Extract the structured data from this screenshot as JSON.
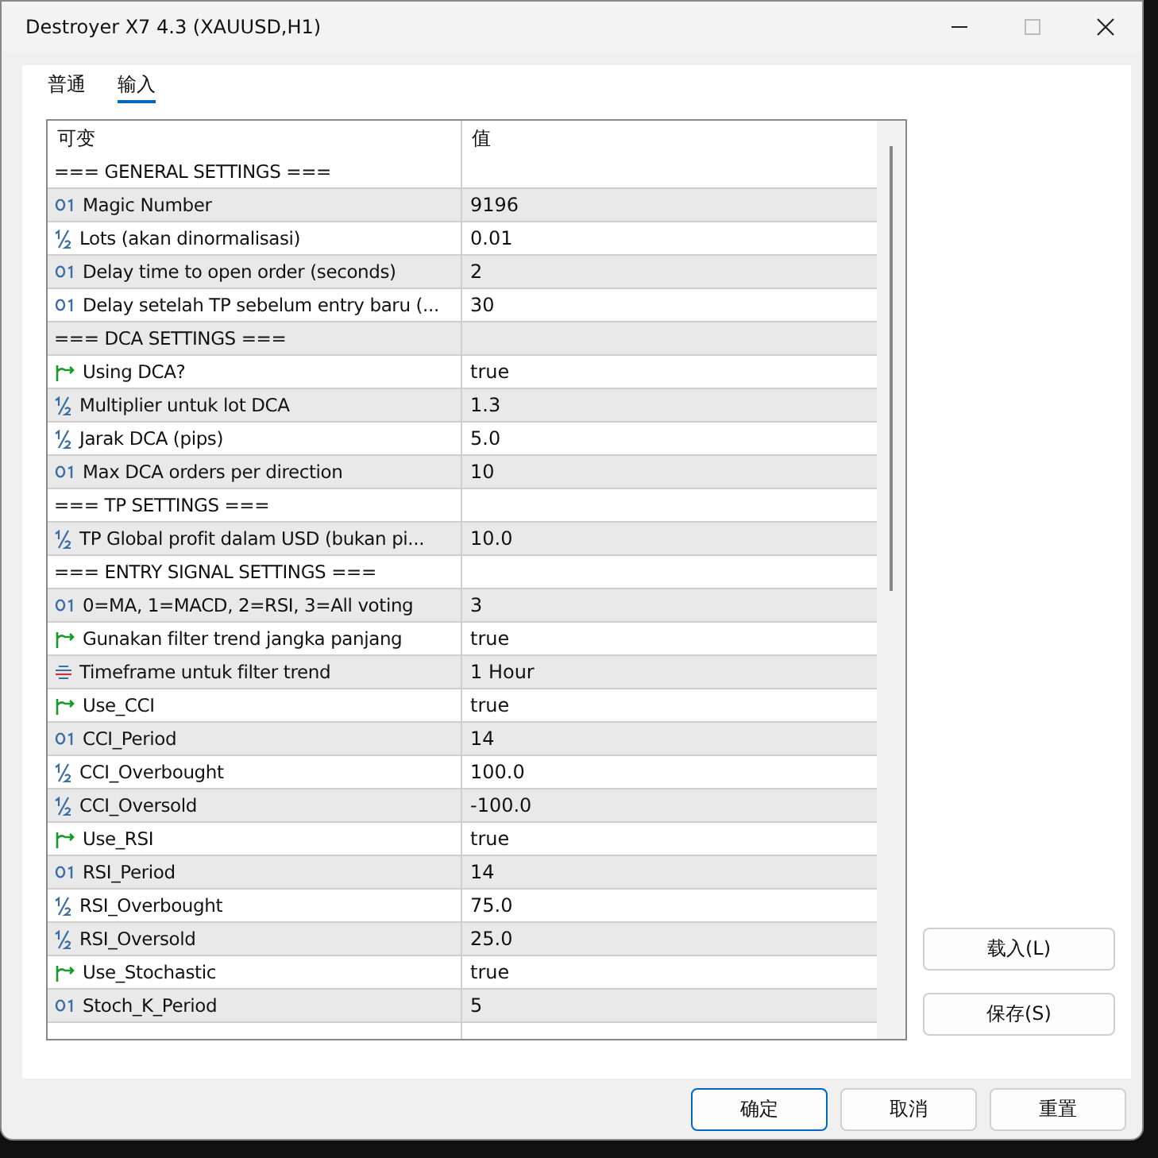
{
  "window": {
    "title": "Destroyer X7 4.3 (XAUUSD,H1)"
  },
  "tabs": [
    {
      "label": "普通",
      "selected": false
    },
    {
      "label": "输入",
      "selected": true
    }
  ],
  "table": {
    "columns": [
      "可变",
      "值"
    ],
    "rows": [
      {
        "kind": "group",
        "name": "=== GENERAL SETTINGS ===",
        "value": ""
      },
      {
        "kind": "int",
        "name": "Magic Number",
        "value": "9196"
      },
      {
        "kind": "double",
        "name": "Lots (akan dinormalisasi)",
        "value": "0.01"
      },
      {
        "kind": "int",
        "name": "Delay time to open order (seconds)",
        "value": "2"
      },
      {
        "kind": "int",
        "name": "Delay setelah TP sebelum entry baru (...",
        "value": "30"
      },
      {
        "kind": "group",
        "name": "=== DCA SETTINGS ===",
        "value": ""
      },
      {
        "kind": "bool",
        "name": "Using DCA?",
        "value": "true"
      },
      {
        "kind": "double",
        "name": "Multiplier untuk lot DCA",
        "value": "1.3"
      },
      {
        "kind": "double",
        "name": "Jarak DCA (pips)",
        "value": "5.0"
      },
      {
        "kind": "int",
        "name": "Max DCA orders per direction",
        "value": "10"
      },
      {
        "kind": "group",
        "name": "=== TP SETTINGS ===",
        "value": ""
      },
      {
        "kind": "double",
        "name": "TP Global profit dalam USD (bukan pi...",
        "value": "10.0"
      },
      {
        "kind": "group",
        "name": "=== ENTRY SIGNAL SETTINGS ===",
        "value": ""
      },
      {
        "kind": "int",
        "name": "0=MA, 1=MACD, 2=RSI, 3=All voting",
        "value": "3"
      },
      {
        "kind": "bool",
        "name": "Gunakan filter trend jangka panjang",
        "value": "true"
      },
      {
        "kind": "enum",
        "name": "Timeframe untuk filter trend",
        "value": "1 Hour"
      },
      {
        "kind": "bool",
        "name": "Use_CCI",
        "value": "true"
      },
      {
        "kind": "int",
        "name": "CCI_Period",
        "value": "14"
      },
      {
        "kind": "double",
        "name": "CCI_Overbought",
        "value": "100.0"
      },
      {
        "kind": "double",
        "name": "CCI_Oversold",
        "value": "-100.0"
      },
      {
        "kind": "bool",
        "name": "Use_RSI",
        "value": "true"
      },
      {
        "kind": "int",
        "name": "RSI_Period",
        "value": "14"
      },
      {
        "kind": "double",
        "name": "RSI_Overbought",
        "value": "75.0"
      },
      {
        "kind": "double",
        "name": "RSI_Oversold",
        "value": "25.0"
      },
      {
        "kind": "bool",
        "name": "Use_Stochastic",
        "value": "true"
      },
      {
        "kind": "int",
        "name": "Stoch_K_Period",
        "value": "5"
      }
    ]
  },
  "side_buttons": [
    "载入(L)",
    "保存(S)"
  ],
  "buttons": [
    {
      "label": "确定",
      "default": true
    },
    {
      "label": "取消",
      "default": false
    },
    {
      "label": "重置",
      "default": false
    }
  ]
}
